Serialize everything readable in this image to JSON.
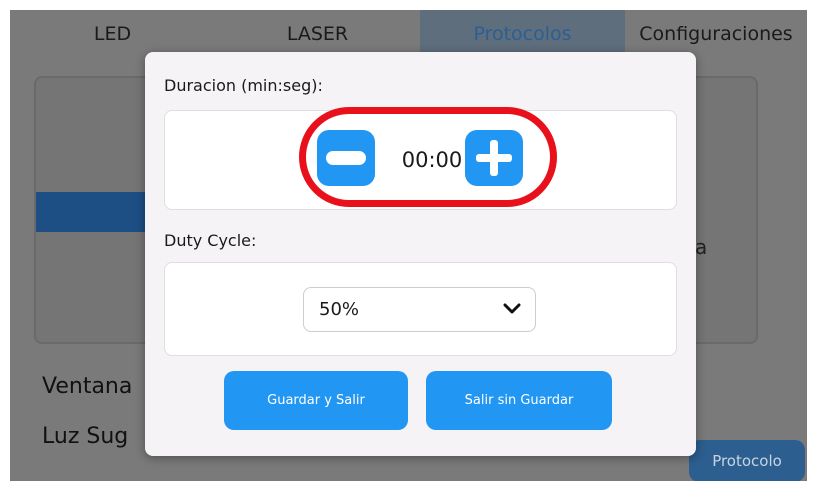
{
  "tabs": [
    {
      "label": "LED"
    },
    {
      "label": "LASER"
    },
    {
      "label": "Protocolos",
      "active": true
    },
    {
      "label": "Configuraciones"
    }
  ],
  "background": {
    "ventana_label": "Ventana",
    "luz_label": "Luz Sug",
    "protocolo_button": "Protocolo",
    "panel_mark": "a"
  },
  "modal": {
    "duration_label": "Duracion (min:seg):",
    "duration_value": "00:00",
    "minus_icon": "minus-icon",
    "plus_icon": "plus-icon",
    "duty_label": "Duty Cycle:",
    "duty_value": "50%",
    "save_button": "Guardar y Salir",
    "exit_button": "Salir sin Guardar"
  },
  "colors": {
    "accent": "#2196f3",
    "highlight": "#e8101a",
    "overlay_bg": "#7a7a7a",
    "modal_bg": "#f5f3f6"
  }
}
